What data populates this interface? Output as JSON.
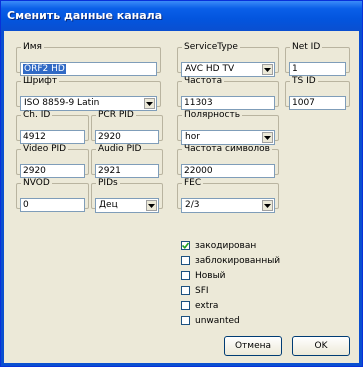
{
  "window": {
    "title": "Сменить данные канала"
  },
  "fields": {
    "name": {
      "label": "Имя",
      "value": "ORF2 HD"
    },
    "service_type": {
      "label": "ServiceType",
      "value": "AVC HD TV"
    },
    "net_id": {
      "label": "Net ID",
      "value": "1"
    },
    "font": {
      "label": "Шрифт",
      "value": "ISO 8859-9 Latin"
    },
    "frequency": {
      "label": "Частота",
      "value": "11303"
    },
    "ts_id": {
      "label": "TS ID",
      "value": "1007"
    },
    "ch_id": {
      "label": "Ch. ID",
      "value": "4912"
    },
    "pcr_pid": {
      "label": "PCR PID",
      "value": "2920"
    },
    "polarity": {
      "label": "Полярность",
      "value": "hor"
    },
    "video_pid": {
      "label": "Video PID",
      "value": "2920"
    },
    "audio_pid": {
      "label": "Audio PID",
      "value": "2921"
    },
    "symbol_rate": {
      "label": "Частота символов",
      "value": "22000"
    },
    "nvod": {
      "label": "NVOD",
      "value": "0"
    },
    "pids": {
      "label": "PIDs",
      "value": "Дец"
    },
    "fec": {
      "label": "FEC",
      "value": "2/3"
    }
  },
  "checkboxes": [
    {
      "label": "закодирован",
      "checked": true
    },
    {
      "label": "заблокированный",
      "checked": false
    },
    {
      "label": "Новый",
      "checked": false
    },
    {
      "label": "SFI",
      "checked": false
    },
    {
      "label": "extra",
      "checked": false
    },
    {
      "label": "unwanted",
      "checked": false
    }
  ],
  "buttons": {
    "cancel": "Отмена",
    "ok": "OK"
  }
}
